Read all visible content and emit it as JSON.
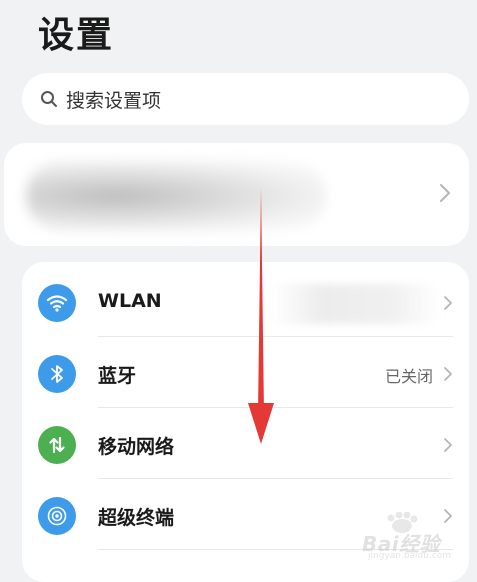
{
  "page": {
    "title": "设置"
  },
  "search": {
    "placeholder": "搜索设置项"
  },
  "settings": {
    "items": [
      {
        "label": "WLAN",
        "value": "",
        "icon": "wifi-icon",
        "color": "#3d9be9"
      },
      {
        "label": "蓝牙",
        "value": "已关闭",
        "icon": "bluetooth-icon",
        "color": "#3d9be9"
      },
      {
        "label": "移动网络",
        "value": "",
        "icon": "mobile-network-icon",
        "color": "#4caf50"
      },
      {
        "label": "超级终端",
        "value": "",
        "icon": "super-device-icon",
        "color": "#3d9be9"
      }
    ]
  },
  "colors": {
    "background": "#f1f2f4",
    "card": "#ffffff",
    "accent_blue": "#3d9be9",
    "accent_green": "#4caf50",
    "annotation_arrow": "#e53935"
  },
  "watermark": {
    "text": "Bai经验",
    "sub": "jingyan.baidu.com"
  }
}
